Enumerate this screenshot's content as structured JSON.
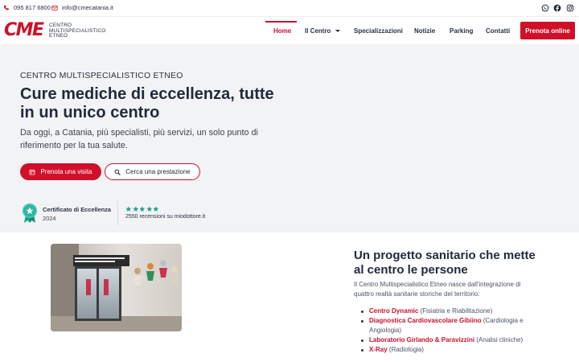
{
  "topbar": {
    "phone": "095 817 6800",
    "email": "info@cmecatania.it",
    "phone_icon": "phone-icon",
    "email_icon": "mail-icon",
    "social": [
      "whatsapp-icon",
      "facebook-icon",
      "instagram-icon"
    ]
  },
  "brand": {
    "mark": "CME",
    "line1": "Centro",
    "line2": "Multispecialistico",
    "line3": "Etneo",
    "color": "#d0102a"
  },
  "nav": {
    "items": [
      "Home",
      "Il Centro",
      "Specializzazioni",
      "Notizie",
      "Parking",
      "Contatti"
    ],
    "active": "Home",
    "cta": "Prenota online"
  },
  "hero": {
    "eyebrow": "Centro Multispecialistico Etneo",
    "title": "Cure mediche di eccellenza, tutte in un unico centro",
    "lead": "Da oggi, a Catania, più specialisti, più servizi, un solo punto di riferimento per la tua salute.",
    "btn_primary": "Prenota una visita",
    "btn_secondary": "Cerca una prestazione",
    "certificate": {
      "title": "Certificato di Eccellenza",
      "year": "2024"
    },
    "rating": {
      "stars": 5,
      "reviews": "2550 recensioni su miodottore.it"
    }
  },
  "about": {
    "title": "Un progetto sanitario che mette al centro le persone",
    "intro": "Il Centro Multispecialistico Etneo nasce dall'integrazione di quattro realtà sanitarie storiche del territorio:",
    "items": [
      {
        "name": "Centro Dynamic",
        "desc": " (Fisiatria e Riabilitazione)"
      },
      {
        "name": "Diagnostica Cardiovascolare Gibiino",
        "desc": " (Cardiologia e Angiologia)"
      },
      {
        "name": "Laboratorio Girlando & Paravizzini",
        "desc": " (Analisi cliniche)"
      },
      {
        "name": "X-Ray",
        "desc": " (Radiologia)"
      }
    ]
  },
  "colors": {
    "accent": "#d0102a",
    "hero_bg": "#f2f3f5",
    "star": "#1aa38c"
  }
}
